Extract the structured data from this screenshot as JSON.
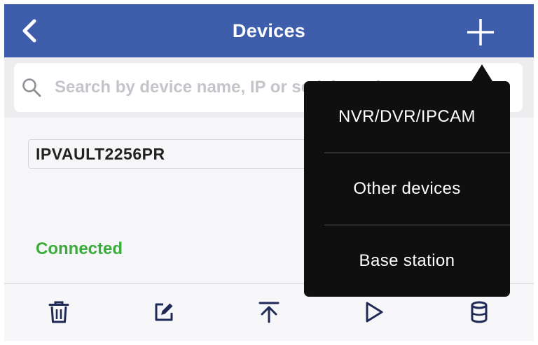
{
  "header": {
    "title": "Devices",
    "back_icon": "chevron-left-icon",
    "add_icon": "plus-icon"
  },
  "search": {
    "placeholder": "Search by device name, IP or serial number",
    "icon": "search-icon"
  },
  "device": {
    "name": "IPVAULT2256PR",
    "status": "Connected"
  },
  "toolbar": {
    "items": [
      {
        "icon": "trash-icon"
      },
      {
        "icon": "edit-icon"
      },
      {
        "icon": "move-to-top-icon"
      },
      {
        "icon": "play-icon"
      },
      {
        "icon": "storage-icon"
      }
    ]
  },
  "add_menu": {
    "items": [
      {
        "label": "NVR/DVR/IPCAM"
      },
      {
        "label": "Other devices"
      },
      {
        "label": "Base station"
      }
    ]
  },
  "colors": {
    "header": "#3e5dab",
    "status_connected": "#3bab3c",
    "menu_background": "#0f0f0f",
    "icon": "#1f2a57"
  }
}
